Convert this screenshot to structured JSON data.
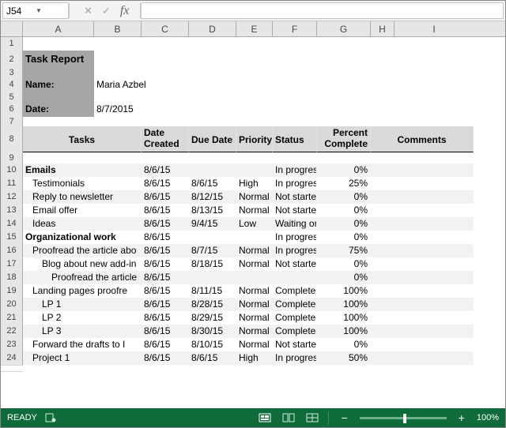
{
  "nameBox": "J54",
  "columns": [
    "A",
    "B",
    "C",
    "D",
    "E",
    "F",
    "G",
    "H",
    "I"
  ],
  "report": {
    "title": "Task Report",
    "nameLabel": "Name:",
    "nameValue": "Maria Azbel",
    "dateLabel": "Date:",
    "dateValue": "8/7/2015"
  },
  "headers": {
    "tasks": "Tasks",
    "dateCreated": "Date Created",
    "dueDate": "Due Date",
    "priority": "Priority",
    "status": "Status",
    "percent": "Percent Complete",
    "comments": "Comments"
  },
  "statusBar": {
    "ready": "READY",
    "zoom": "100%"
  },
  "rows": [
    {
      "n": 10,
      "band": true,
      "bold": true,
      "ind": 0,
      "task": "Emails",
      "dc": "8/6/15",
      "dd": "",
      "pr": "",
      "st": "In progress",
      "pc": "0%"
    },
    {
      "n": 11,
      "band": false,
      "bold": false,
      "ind": 1,
      "task": "Testimonials",
      "dc": "8/6/15",
      "dd": "8/6/15",
      "pr": "High",
      "st": "In progress",
      "pc": "25%"
    },
    {
      "n": 12,
      "band": true,
      "bold": false,
      "ind": 1,
      "task": "Reply to newsletter",
      "dc": "8/6/15",
      "dd": "8/12/15",
      "pr": "Normal",
      "st": "Not started",
      "pc": "0%"
    },
    {
      "n": 13,
      "band": false,
      "bold": false,
      "ind": 1,
      "task": "Email offer",
      "dc": "8/6/15",
      "dd": "8/13/15",
      "pr": "Normal",
      "st": "Not started",
      "pc": "0%"
    },
    {
      "n": 14,
      "band": true,
      "bold": false,
      "ind": 1,
      "task": "Ideas",
      "dc": "8/6/15",
      "dd": "9/4/15",
      "pr": "Low",
      "st": "Waiting on",
      "pc": "0%"
    },
    {
      "n": 15,
      "band": false,
      "bold": true,
      "ind": 0,
      "task": "Organizational work",
      "dc": "8/6/15",
      "dd": "",
      "pr": "",
      "st": "In progress",
      "pc": "0%"
    },
    {
      "n": 16,
      "band": true,
      "bold": false,
      "ind": 1,
      "task": "Proofread the article abo",
      "dc": "8/6/15",
      "dd": "8/7/15",
      "pr": "Normal",
      "st": "In progress",
      "pc": "75%"
    },
    {
      "n": 17,
      "band": false,
      "bold": false,
      "ind": 2,
      "task": "Blog about new add-in",
      "dc": "8/6/15",
      "dd": "8/18/15",
      "pr": "Normal",
      "st": "Not started",
      "pc": "0%"
    },
    {
      "n": 18,
      "band": true,
      "bold": false,
      "ind": 3,
      "task": "Proofread the article",
      "dc": "8/6/15",
      "dd": "",
      "pr": "",
      "st": "",
      "pc": "0%"
    },
    {
      "n": 19,
      "band": false,
      "bold": false,
      "ind": 1,
      "task": "Landing pages proofre",
      "dc": "8/6/15",
      "dd": "8/11/15",
      "pr": "Normal",
      "st": "Completed",
      "pc": "100%"
    },
    {
      "n": 20,
      "band": true,
      "bold": false,
      "ind": 2,
      "task": "LP 1",
      "dc": "8/6/15",
      "dd": "8/28/15",
      "pr": "Normal",
      "st": "Completed",
      "pc": "100%"
    },
    {
      "n": 21,
      "band": false,
      "bold": false,
      "ind": 2,
      "task": "LP 2",
      "dc": "8/6/15",
      "dd": "8/29/15",
      "pr": "Normal",
      "st": "Completed",
      "pc": "100%"
    },
    {
      "n": 22,
      "band": true,
      "bold": false,
      "ind": 2,
      "task": "LP 3",
      "dc": "8/6/15",
      "dd": "8/30/15",
      "pr": "Normal",
      "st": "Completed",
      "pc": "100%"
    },
    {
      "n": 23,
      "band": false,
      "bold": false,
      "ind": 1,
      "task": "Forward the drafts to I",
      "dc": "8/6/15",
      "dd": "8/10/15",
      "pr": "Normal",
      "st": "Not started",
      "pc": "0%"
    },
    {
      "n": 24,
      "band": true,
      "bold": false,
      "ind": 1,
      "task": "Project 1",
      "dc": "8/6/15",
      "dd": "8/6/15",
      "pr": "High",
      "st": "In progress",
      "pc": "50%"
    }
  ]
}
